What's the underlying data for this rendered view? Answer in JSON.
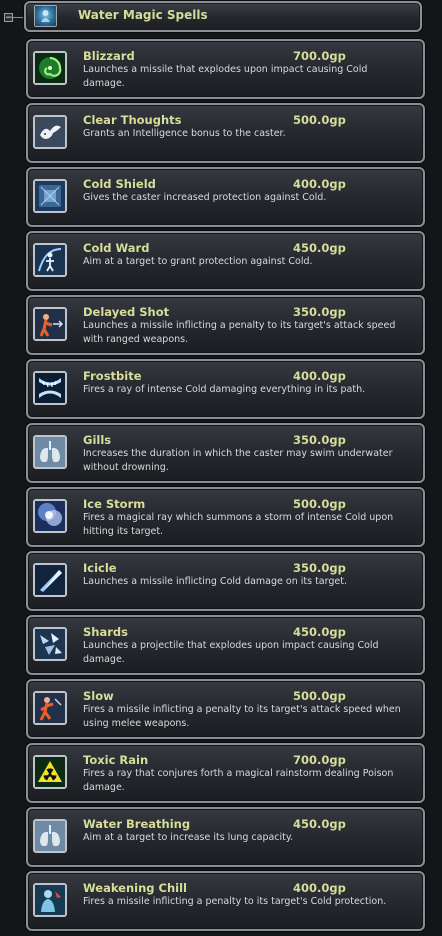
{
  "category": {
    "title": "Water Magic Spells",
    "icon": "water-magic-icon"
  },
  "spells": [
    {
      "name": "Blizzard",
      "price": "700.0gp",
      "description": "Launches a missile that explodes upon impact causing Cold damage.",
      "icon": "blizzard-icon"
    },
    {
      "name": "Clear Thoughts",
      "price": "500.0gp",
      "description": "Grants an Intelligence bonus to the caster.",
      "icon": "dove-icon"
    },
    {
      "name": "Cold Shield",
      "price": "400.0gp",
      "description": "Gives the caster increased protection against Cold.",
      "icon": "cold-shield-icon"
    },
    {
      "name": "Cold Ward",
      "price": "450.0gp",
      "description": "Aim at a target to grant protection against Cold.",
      "icon": "cold-ward-icon"
    },
    {
      "name": "Delayed Shot",
      "price": "350.0gp",
      "description": "Launches a missile inflicting a penalty to its target's attack speed with ranged weapons.",
      "icon": "delayed-shot-icon"
    },
    {
      "name": "Frostbite",
      "price": "400.0gp",
      "description": "Fires a ray of intense Cold damaging everything in its path.",
      "icon": "frostbite-icon"
    },
    {
      "name": "Gills",
      "price": "350.0gp",
      "description": "Increases the duration in which the caster may swim underwater without drowning.",
      "icon": "lungs-icon"
    },
    {
      "name": "Ice Storm",
      "price": "500.0gp",
      "description": "Fires a magical ray which summons a storm of intense Cold upon hitting its target.",
      "icon": "ice-storm-icon"
    },
    {
      "name": "Icicle",
      "price": "350.0gp",
      "description": "Launches a missile inflicting Cold damage on its target.",
      "icon": "icicle-icon"
    },
    {
      "name": "Shards",
      "price": "450.0gp",
      "description": "Launches a projectile that explodes upon impact causing Cold damage.",
      "icon": "shards-icon"
    },
    {
      "name": "Slow",
      "price": "500.0gp",
      "description": "Fires a missile inflicting a penalty to its target's attack speed when using melee weapons.",
      "icon": "slow-icon"
    },
    {
      "name": "Toxic Rain",
      "price": "700.0gp",
      "description": "Fires a ray that conjures forth a magical rainstorm dealing Poison damage.",
      "icon": "radiation-icon"
    },
    {
      "name": "Water Breathing",
      "price": "450.0gp",
      "description": "Aim at a target to increase its lung capacity.",
      "icon": "lungs-icon"
    },
    {
      "name": "Weakening Chill",
      "price": "400.0gp",
      "description": "Fires a missile inflicting a penalty to its target's Cold protection.",
      "icon": "weakening-chill-icon"
    }
  ]
}
